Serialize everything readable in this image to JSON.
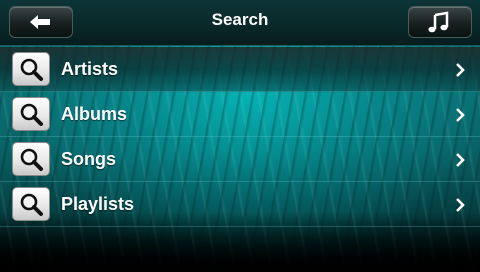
{
  "header": {
    "title": "Search",
    "back_button_icon": "back-arrow-icon",
    "music_button_icon": "music-note-icon"
  },
  "menu": {
    "items": [
      {
        "label": "Artists",
        "icon": "search-icon",
        "selected": true
      },
      {
        "label": "Albums",
        "icon": "search-icon",
        "selected": false
      },
      {
        "label": "Songs",
        "icon": "search-icon",
        "selected": false
      },
      {
        "label": "Playlists",
        "icon": "search-icon",
        "selected": false
      }
    ]
  },
  "colors": {
    "accent": "#0aa6aa",
    "header_bg": "#0a2a2b",
    "text": "#ffffff"
  }
}
